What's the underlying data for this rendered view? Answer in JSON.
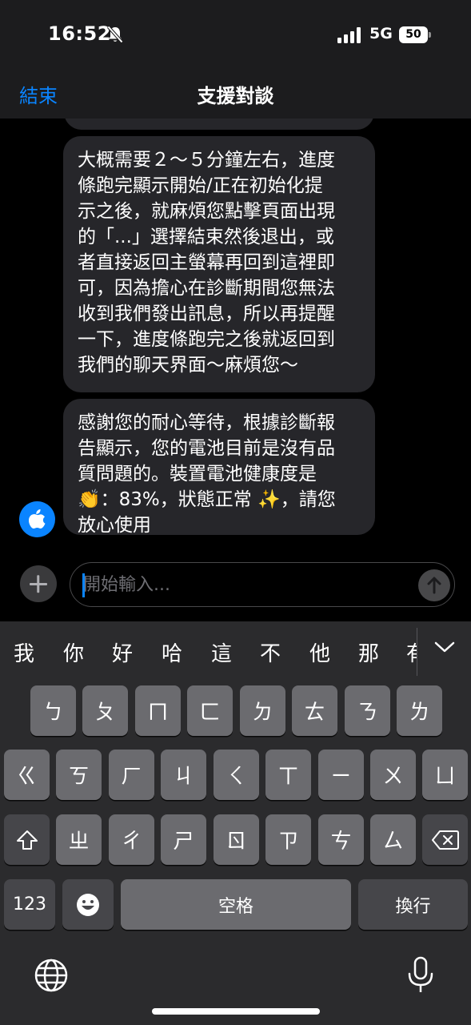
{
  "status_bar": {
    "time": "16:52",
    "network": "5G",
    "battery": "50"
  },
  "header": {
    "end_label": "結束",
    "title": "支援對談"
  },
  "messages": [
    {
      "lines": [
        "大概需要２～５分鐘左右，進度",
        "條跑完顯示開始/正在初始化提",
        "示之後，就麻煩您點擊頁面出現",
        "的「...」選擇結束然後退出，或",
        "者直接返回主螢幕再回到這裡即",
        "可，因為擔心在診斷期間您無法",
        "收到我們發出訊息，所以再提醒",
        "一下，進度條跑完之後就返回到",
        "我們的聊天界面～麻煩您～"
      ]
    },
    {
      "lines": [
        "感謝您的耐心等待，根據診斷報",
        "告顯示，您的電池目前是沒有品",
        "質問題的。裝置電池健康度是",
        "👏：83%，狀態正常 ✨，請您",
        "放心使用"
      ]
    }
  ],
  "input": {
    "placeholder": "開始輸入..."
  },
  "keyboard": {
    "candidates": [
      "我",
      "你",
      "好",
      "哈",
      "這",
      "不",
      "他",
      "那",
      "有"
    ],
    "row1": [
      "ㄅ",
      "ㄆ",
      "ㄇ",
      "ㄈ",
      "ㄉ",
      "ㄊ",
      "ㄋ",
      "ㄌ"
    ],
    "row2": [
      "ㄍ",
      "ㄎ",
      "ㄏ",
      "ㄐ",
      "ㄑ",
      "ㄒ",
      "ㄧ",
      "ㄨ",
      "ㄩ"
    ],
    "row3": [
      "ㄓ",
      "ㄔ",
      "ㄕ",
      "ㄖ",
      "ㄗ",
      "ㄘ",
      "ㄙ"
    ],
    "numbers_label": "123",
    "space_label": "空格",
    "return_label": "換行"
  }
}
